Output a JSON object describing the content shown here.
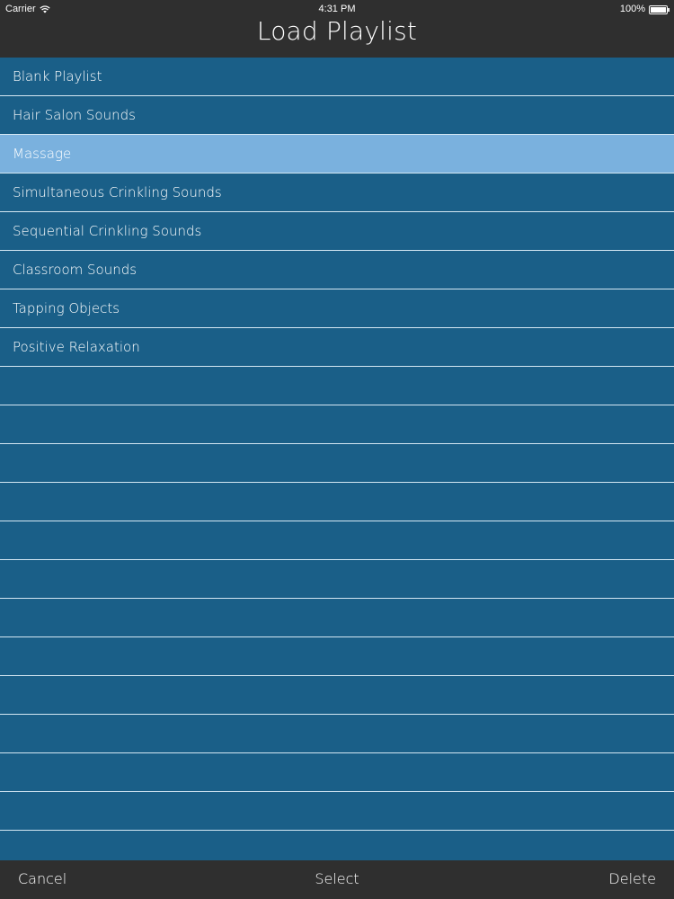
{
  "status_bar": {
    "carrier": "Carrier",
    "time": "4:31 PM",
    "battery_percent": "100%",
    "icons": [
      "wifi-icon",
      "battery-icon"
    ]
  },
  "header": {
    "title": "Load Playlist"
  },
  "playlists": [
    {
      "label": "Blank Playlist",
      "selected": false
    },
    {
      "label": "Hair Salon Sounds",
      "selected": false
    },
    {
      "label": "Massage",
      "selected": true
    },
    {
      "label": "Simultaneous Crinkling Sounds",
      "selected": false
    },
    {
      "label": "Sequential Crinkling Sounds",
      "selected": false
    },
    {
      "label": "Classroom Sounds",
      "selected": false
    },
    {
      "label": "Tapping Objects",
      "selected": false
    },
    {
      "label": "Positive Relaxation",
      "selected": false
    }
  ],
  "empty_rows": 13,
  "toolbar": {
    "cancel_label": "Cancel",
    "select_label": "Select",
    "delete_label": "Delete"
  },
  "colors": {
    "list_background": "#1a5f88",
    "selected_row": "#7ab1de",
    "bar_background": "#2f2f2f",
    "row_divider": "#d4e7f3",
    "text": "#ffffff"
  }
}
